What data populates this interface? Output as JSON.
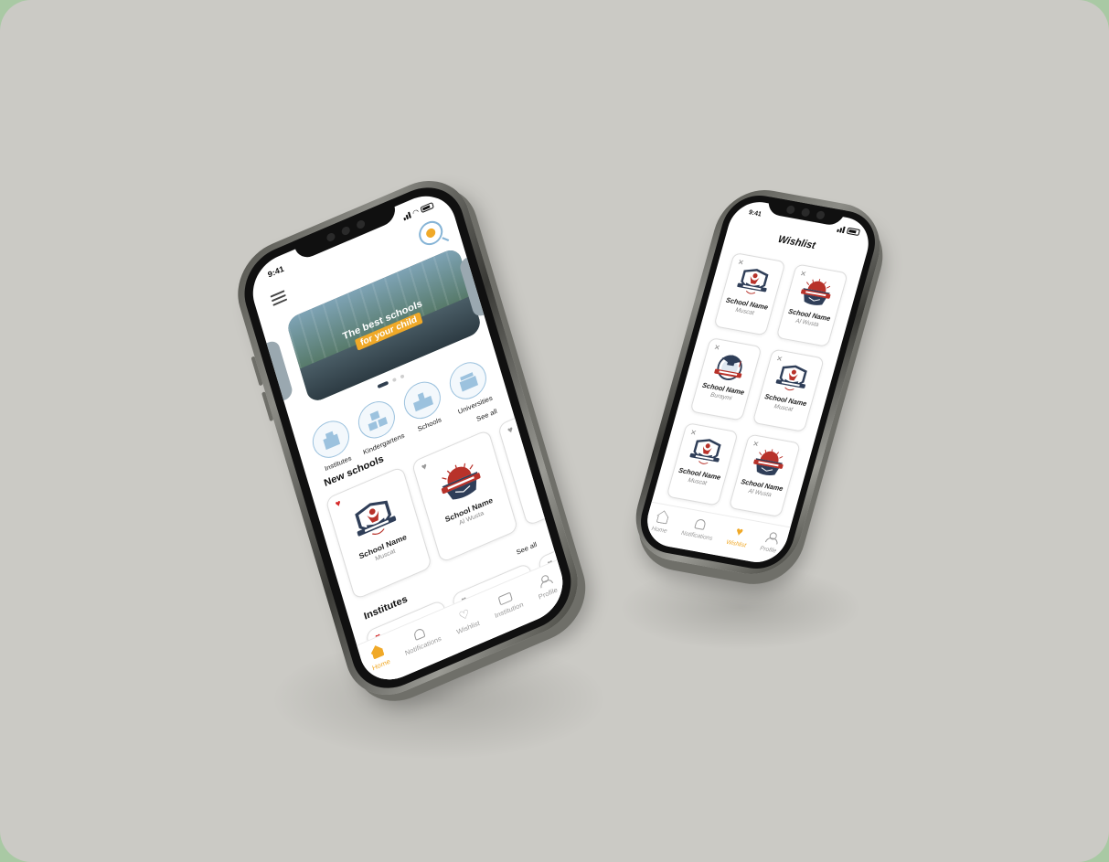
{
  "colors": {
    "accent": "#f0a928",
    "heart_active": "#d62828",
    "icon_blue": "#9cc2de",
    "logo_navy": "#2f3e58",
    "logo_red": "#b8322a",
    "background": "#cbcac5"
  },
  "home_phone": {
    "status_time": "9:41",
    "menu_icon": "hamburger-icon",
    "search_icon": "search-icon",
    "banner": {
      "line1": "The best schools",
      "line2": "for your child"
    },
    "categories": [
      {
        "label": "Institutes",
        "icon": "building-icon"
      },
      {
        "label": "Kindergartens",
        "icon": "abc-blocks-icon"
      },
      {
        "label": "Schools",
        "icon": "school-icon"
      },
      {
        "label": "Universities",
        "icon": "university-icon"
      }
    ],
    "new_schools": {
      "title": "New schools",
      "see_all": "See all",
      "cards": [
        {
          "name": "School Name",
          "location": "Muscat",
          "favorite": true,
          "logo": "university-logo"
        },
        {
          "name": "School Name",
          "location": "Al Wusta",
          "favorite": false,
          "logo": "college-logo"
        },
        {
          "name": "Sch",
          "location": "",
          "favorite": false,
          "logo": "university-logo"
        }
      ]
    },
    "institutes": {
      "title": "Institutes",
      "see_all": "See all"
    },
    "tabs": [
      {
        "label": "Home",
        "icon": "home-icon",
        "active": true
      },
      {
        "label": "Notifications",
        "icon": "bell-icon",
        "active": false
      },
      {
        "label": "Wishlist",
        "icon": "heart-icon",
        "active": false
      },
      {
        "label": "Institution",
        "icon": "briefcase-icon",
        "active": false
      },
      {
        "label": "Profile",
        "icon": "user-icon",
        "active": false
      }
    ]
  },
  "wishlist_phone": {
    "status_time": "9:41",
    "title": "Wishlist",
    "items": [
      {
        "name": "School Name",
        "location": "Muscat",
        "logo": "university-logo"
      },
      {
        "name": "School Name",
        "location": "Al Wusta",
        "logo": "college-logo"
      },
      {
        "name": "School Name",
        "location": "Buraymi",
        "logo": "graduation-cap-logo"
      },
      {
        "name": "School Name",
        "location": "Muscat",
        "logo": "university-logo"
      },
      {
        "name": "School Name",
        "location": "Muscat",
        "logo": "university-logo"
      },
      {
        "name": "School Name",
        "location": "Al Wusta",
        "logo": "college-logo"
      }
    ],
    "tabs": [
      {
        "label": "Home",
        "icon": "home-icon",
        "active": false
      },
      {
        "label": "Notifications",
        "icon": "bell-icon",
        "active": false
      },
      {
        "label": "Wishlist",
        "icon": "heart-icon",
        "active": true
      },
      {
        "label": "Profile",
        "icon": "user-icon",
        "active": false
      }
    ]
  }
}
